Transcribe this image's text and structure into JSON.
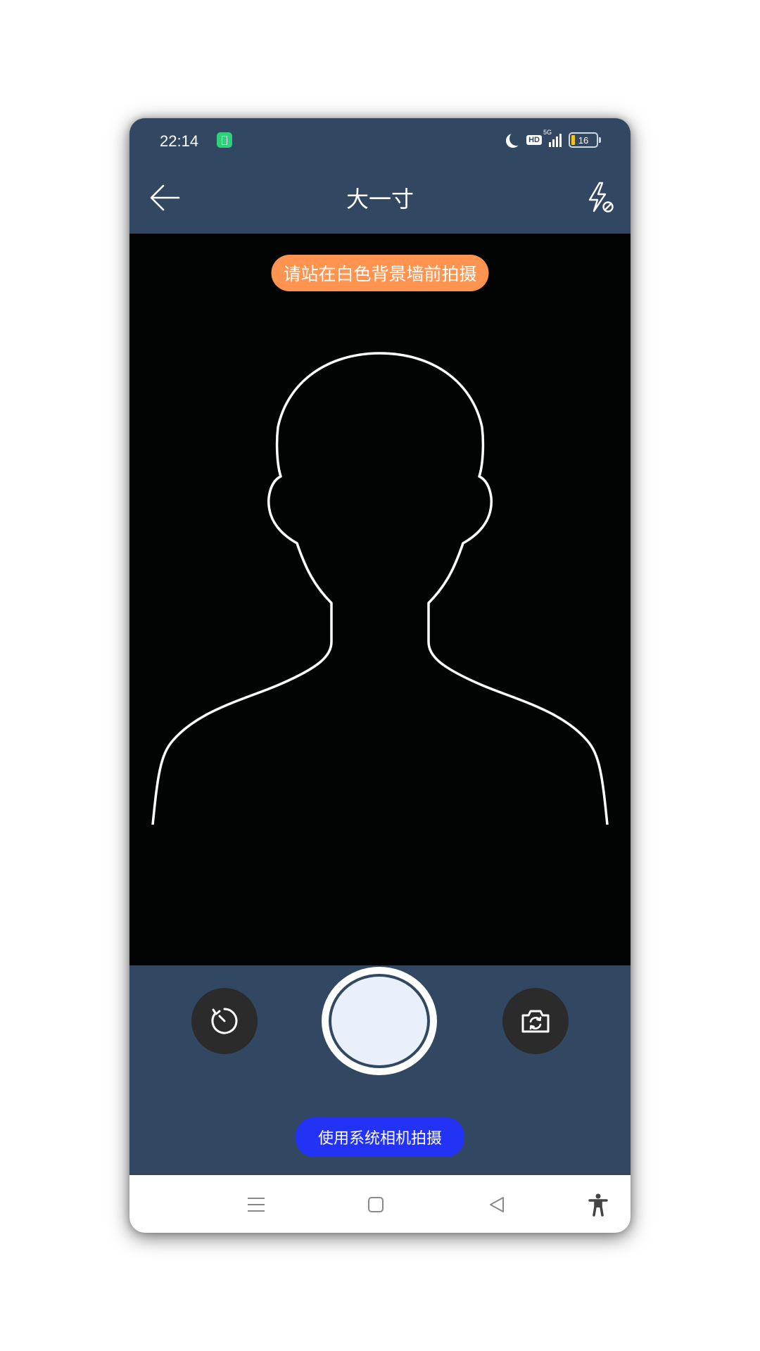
{
  "status_bar": {
    "time": "22:14",
    "icons": [
      "battery-saver-icon",
      "moon-icon",
      "hd-icon",
      "signal-5g-icon",
      "battery-icon"
    ],
    "hd_label": "HD",
    "network_label": "5G",
    "battery_level": "16"
  },
  "header": {
    "title": "大一寸",
    "back_icon": "arrow-left-icon",
    "flash_icon": "flash-off-icon"
  },
  "viewfinder": {
    "hint": "请站在白色背景墙前拍摄",
    "guide": "portrait-silhouette-outline"
  },
  "controls": {
    "timer_icon": "timer-icon",
    "switch_camera_icon": "switch-camera-icon",
    "system_camera_label": "使用系统相机拍摄"
  },
  "colors": {
    "toolbar_bg": "#324862",
    "viewfinder_bg": "#020303",
    "hint_bg": "#fe9450",
    "system_camera_bg": "#2333f5",
    "shutter_fill": "#e9f0fc"
  },
  "nav_bar": {
    "icons": [
      "menu-icon",
      "home-icon",
      "back-triangle-icon",
      "accessibility-icon"
    ]
  }
}
